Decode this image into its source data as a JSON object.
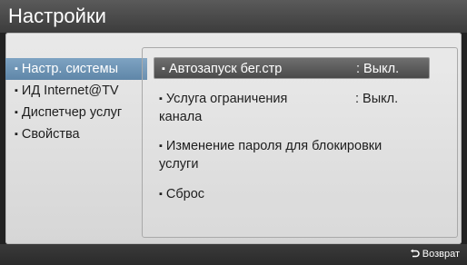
{
  "header": {
    "title": "Настройки"
  },
  "left_menu": {
    "items": [
      {
        "label": "Настр. системы",
        "active": true
      },
      {
        "label": "ИД Internet@TV",
        "active": false
      },
      {
        "label": "Диспетчер услуг",
        "active": false
      },
      {
        "label": "Свойства",
        "active": false
      }
    ]
  },
  "right_menu": {
    "items": [
      {
        "label": "Автозапуск бег.стр",
        "value": ": Выкл.",
        "selected": true
      },
      {
        "label_line1": "Услуга ограничения",
        "label_line2": "канала",
        "value": ": Выкл."
      },
      {
        "label_line1": "Изменение пароля для блокировки",
        "label_line2": "услуги"
      },
      {
        "label": "Сброс"
      }
    ]
  },
  "footer": {
    "return_label": "Возврат",
    "return_icon": "return-arrow-icon"
  },
  "colors": {
    "highlight": "#6f93b4",
    "panel": "#e0e0e0",
    "title_bar": "#4a4a4a"
  }
}
